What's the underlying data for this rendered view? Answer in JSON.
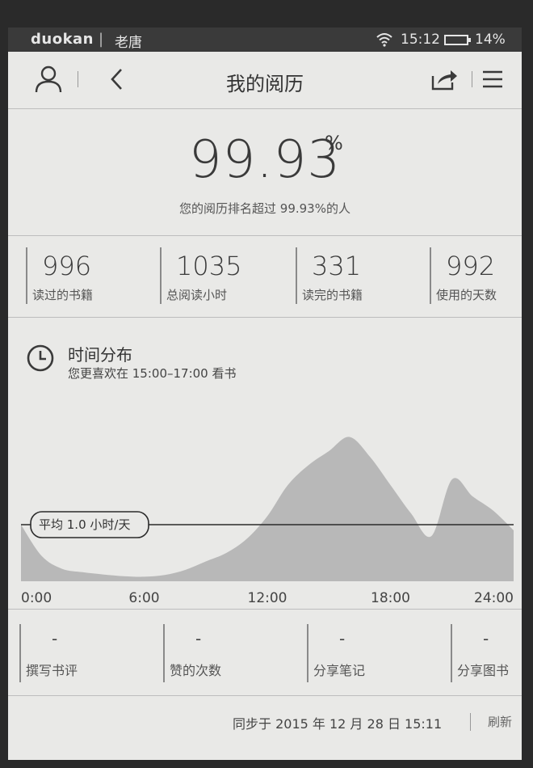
{
  "status_bar": {
    "brand": "duokan",
    "user": "老唐",
    "time": "15:12",
    "battery": "14%"
  },
  "header": {
    "title": "我的阅历",
    "icons": [
      "user-icon",
      "back-icon",
      "share-icon",
      "menu-icon"
    ]
  },
  "ranking": {
    "value": "99.93",
    "unit": "%",
    "description": "您的阅历排名超过 99.93%的人"
  },
  "stats": [
    {
      "value": "996",
      "label": "读过的书籍"
    },
    {
      "value": "1035",
      "label": "总阅读小时"
    },
    {
      "value": "331",
      "label": "读完的书籍"
    },
    {
      "value": "992",
      "label": "使用的天数"
    }
  ],
  "distribution": {
    "title": "时间分布",
    "subtitle": "您更喜欢在 15:00–17:00 看书",
    "average_label": "平均 1.0 小时/天"
  },
  "chart_data": {
    "type": "area",
    "x_ticks": [
      "0:00",
      "6:00",
      "12:00",
      "18:00",
      "24:00"
    ],
    "x": [
      0,
      1,
      2,
      3,
      4,
      5,
      6,
      7,
      8,
      9,
      10,
      11,
      12,
      13,
      14,
      15,
      16,
      17,
      18,
      19,
      20,
      21,
      22,
      23,
      24
    ],
    "y": [
      1.0,
      0.45,
      0.22,
      0.16,
      0.12,
      0.09,
      0.08,
      0.11,
      0.2,
      0.35,
      0.5,
      0.75,
      1.15,
      1.7,
      2.05,
      2.3,
      2.55,
      2.2,
      1.7,
      1.2,
      0.8,
      1.8,
      1.5,
      1.25,
      0.9
    ],
    "average": 1.0,
    "ylim": [
      0,
      2.8
    ],
    "grid": false,
    "fill_color": "#b8b8b8"
  },
  "counters": [
    {
      "value": "-",
      "label": "撰写书评"
    },
    {
      "value": "-",
      "label": "赞的次数"
    },
    {
      "value": "-",
      "label": "分享笔记"
    },
    {
      "value": "-",
      "label": "分享图书"
    }
  ],
  "footer": {
    "sync_text": "同步于 2015 年 12 月 28 日 15:11",
    "refresh_label": "刷新"
  }
}
